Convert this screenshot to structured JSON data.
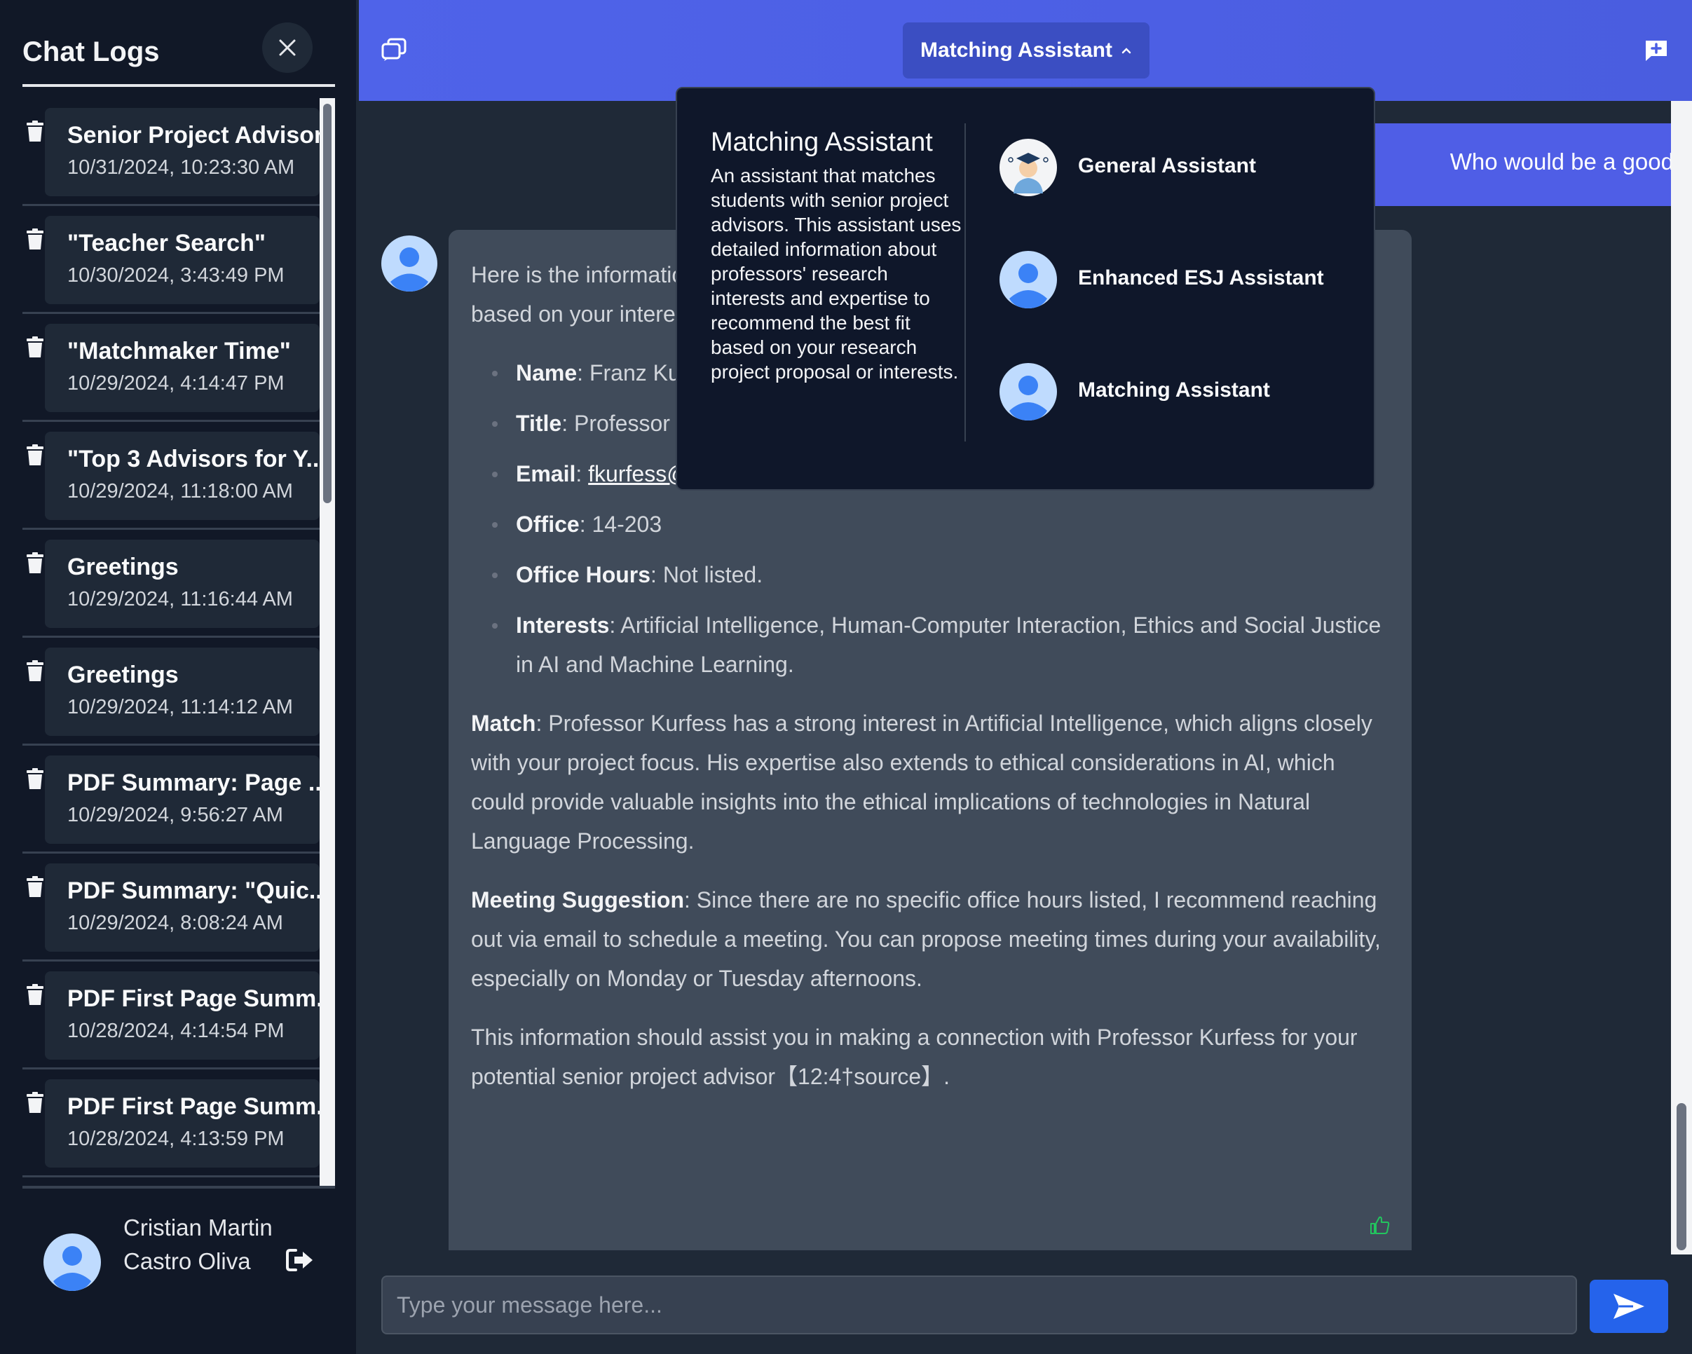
{
  "sidebar": {
    "title": "Chat Logs",
    "logs": [
      {
        "title": "Senior Project Advisor",
        "date": "10/31/2024, 10:23:30 AM"
      },
      {
        "title": "\"Teacher Search\"",
        "date": "10/30/2024, 3:43:49 PM"
      },
      {
        "title": "\"Matchmaker Time\"",
        "date": "10/29/2024, 4:14:47 PM"
      },
      {
        "title": "\"Top 3 Advisors for Y...",
        "date": "10/29/2024, 11:18:00 AM"
      },
      {
        "title": "Greetings",
        "date": "10/29/2024, 11:16:44 AM"
      },
      {
        "title": "Greetings",
        "date": "10/29/2024, 11:14:12 AM"
      },
      {
        "title": "PDF Summary: Page ...",
        "date": "10/29/2024, 9:56:27 AM"
      },
      {
        "title": "PDF Summary: \"Quic...",
        "date": "10/29/2024, 8:08:24 AM"
      },
      {
        "title": "PDF First Page Summ...",
        "date": "10/28/2024, 4:14:54 PM"
      },
      {
        "title": "PDF First Page Summ...",
        "date": "10/28/2024, 4:13:59 PM"
      }
    ],
    "user_name": "Cristian Martin Castro Oliva"
  },
  "header": {
    "assistant_selector": "Matching Assistant"
  },
  "dropdown": {
    "title": "Matching Assistant",
    "description": "An assistant that matches students with senior project advisors. This assistant uses detailed information about professors' research interests and expertise to recommend the best fit based on your research project proposal or interests.",
    "options": [
      {
        "label": "General Assistant",
        "icon": "graduate-avatar-icon"
      },
      {
        "label": "Enhanced ESJ Assistant",
        "icon": "user-avatar-icon"
      },
      {
        "label": "Matching Assistant",
        "icon": "user-avatar-icon"
      }
    ]
  },
  "chat": {
    "user_message": "Who would be a good advisor for my senior project?",
    "bot": {
      "intro": "Here is the information on a professor who could be a good advisor for your senior project based on your interest in Artificial Intelligence and Natural Language Processing:",
      "details": [
        {
          "key": "Name",
          "value": ": Franz Kurfess"
        },
        {
          "key": "Title",
          "value": ": Professor"
        },
        {
          "key": "Email",
          "value": ": ",
          "link": "fkurfess@calpoly.edu"
        },
        {
          "key": "Office",
          "value": ": 14-203"
        },
        {
          "key": "Office Hours",
          "value": ": Not listed."
        },
        {
          "key": "Interests",
          "value": ": Artificial Intelligence, Human-Computer Interaction, Ethics and Social Justice in AI and Machine Learning."
        }
      ],
      "match_label": "Match",
      "match_text": ": Professor Kurfess has a strong interest in Artificial Intelligence, which aligns closely with your project focus. His expertise also extends to ethical considerations in AI, which could provide valuable insights into the ethical implications of technologies in Natural Language Processing.",
      "meeting_label": "Meeting Suggestion",
      "meeting_text": ": Since there are no specific office hours listed, I recommend reaching out via email to schedule a meeting. You can propose meeting times during your availability, especially on Monday or Tuesday afternoons.",
      "closing": "This information should assist you in making a connection with Professor Kurfess for your potential senior project advisor【12:4†source】."
    }
  },
  "input": {
    "placeholder": "Type your message here..."
  },
  "colors": {
    "accent": "#4f63e9",
    "sidebar_bg": "#111827",
    "chat_bg": "#1f2937",
    "send_button": "#2563eb"
  }
}
